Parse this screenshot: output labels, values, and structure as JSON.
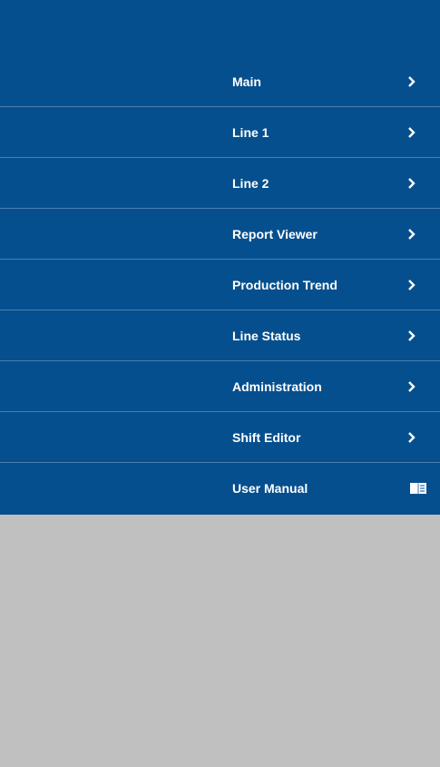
{
  "menu": {
    "items": [
      {
        "label": "Main",
        "icon": "chevron-right-icon"
      },
      {
        "label": "Line 1",
        "icon": "chevron-right-icon"
      },
      {
        "label": "Line 2",
        "icon": "chevron-right-icon"
      },
      {
        "label": "Report Viewer",
        "icon": "chevron-right-icon"
      },
      {
        "label": "Production Trend",
        "icon": "chevron-right-icon"
      },
      {
        "label": "Line Status",
        "icon": "chevron-right-icon"
      },
      {
        "label": "Administration",
        "icon": "chevron-right-icon"
      },
      {
        "label": "Shift Editor",
        "icon": "chevron-right-icon"
      },
      {
        "label": "User Manual",
        "icon": "book-icon"
      }
    ]
  },
  "colors": {
    "menu_background": "#064f8e",
    "divider": "#4a7fb0",
    "page_background": "#c0c0c0",
    "text": "#ffffff"
  }
}
